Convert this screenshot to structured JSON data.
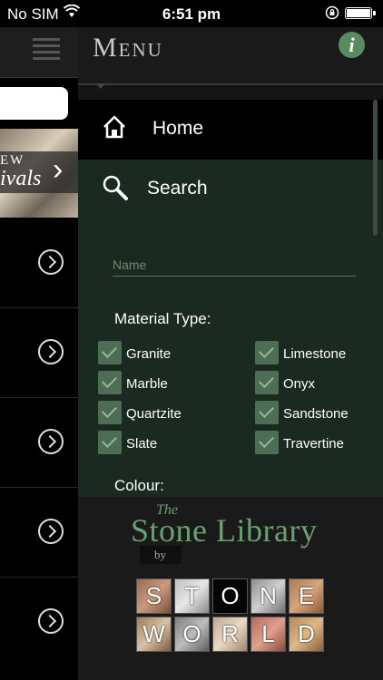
{
  "status_bar": {
    "carrier": "No SIM",
    "time": "6:51 pm"
  },
  "background_page": {
    "banner_line1": "EW",
    "banner_line2": "ivals"
  },
  "menu": {
    "title": "Menu",
    "info_label": "i",
    "nav": {
      "home": "Home",
      "search": "Search"
    },
    "search_form": {
      "name_placeholder": "Name",
      "material_type_label": "Material Type:",
      "materials_left": [
        {
          "label": "Granite",
          "checked": true
        },
        {
          "label": "Marble",
          "checked": true
        },
        {
          "label": "Quartzite",
          "checked": true
        },
        {
          "label": "Slate",
          "checked": true
        }
      ],
      "materials_right": [
        {
          "label": "Limestone",
          "checked": true
        },
        {
          "label": "Onyx",
          "checked": true
        },
        {
          "label": "Sandstone",
          "checked": true
        },
        {
          "label": "Travertine",
          "checked": true
        }
      ],
      "colour_label": "Colour:"
    }
  },
  "logo": {
    "the": "The",
    "name": "Stone Library",
    "by": "by",
    "tiles_row1": [
      "S",
      "T",
      "O",
      "N",
      "E"
    ],
    "tiles_row2": [
      "W",
      "O",
      "R",
      "L",
      "D"
    ]
  },
  "colors": {
    "accent_green": "#6aa06f",
    "checkbox_green": "#4d6e55",
    "panel_green": "#1b2a20"
  }
}
